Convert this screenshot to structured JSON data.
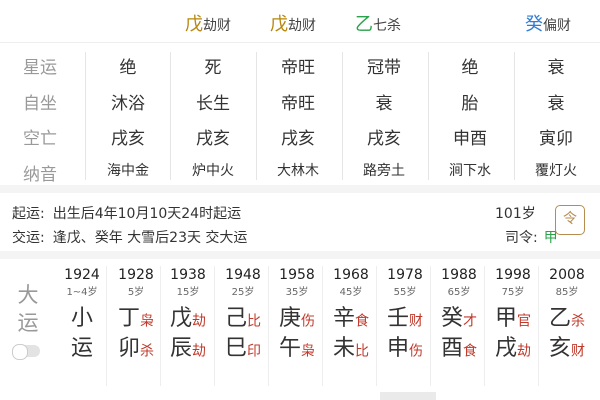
{
  "top_strip": [
    {
      "stem": "戊",
      "god": "劫财",
      "color": "#b8860b"
    },
    {
      "stem": "戊",
      "god": "劫财",
      "color": "#b8860b"
    },
    {
      "stem": "乙",
      "god": "七杀",
      "color": "#2aa24a"
    },
    {
      "stem": "癸",
      "god": "偏财",
      "color": "#2f7dd6"
    }
  ],
  "grid": {
    "rows": [
      {
        "label": "星运",
        "cells": [
          "绝",
          "死",
          "帝旺",
          "冠带",
          "绝",
          "衰"
        ]
      },
      {
        "label": "自坐",
        "cells": [
          "沐浴",
          "长生",
          "帝旺",
          "衰",
          "胎",
          "衰"
        ]
      },
      {
        "label": "空亡",
        "cells": [
          "戌亥",
          "戌亥",
          "戌亥",
          "戌亥",
          "申酉",
          "寅卯"
        ]
      },
      {
        "label": "纳音",
        "cells": [
          "海中金",
          "炉中火",
          "大林木",
          "路旁土",
          "涧下水",
          "覆灯火"
        ]
      }
    ]
  },
  "info": {
    "qiyun_label": "起运:",
    "qiyun_value": "出生后4年10月10天24时起运",
    "jiaoyun_label": "交运:",
    "jiaoyun_value": "逢戊、癸年 大雪后23天 交大运",
    "age_right": "101岁",
    "siling_label": "司令:",
    "siling_value": "甲",
    "ling_icon_char": "令"
  },
  "dayun": {
    "title": [
      "大",
      "运"
    ],
    "columns": [
      {
        "year": "1924",
        "age": "1~4岁",
        "g1": "小",
        "s1": "",
        "g2": "运",
        "s2": ""
      },
      {
        "year": "1928",
        "age": "5岁",
        "g1": "丁",
        "s1": "枭",
        "g2": "卯",
        "s2": "杀"
      },
      {
        "year": "1938",
        "age": "15岁",
        "g1": "戊",
        "s1": "劫",
        "g2": "辰",
        "s2": "劫"
      },
      {
        "year": "1948",
        "age": "25岁",
        "g1": "己",
        "s1": "比",
        "g2": "巳",
        "s2": "印"
      },
      {
        "year": "1958",
        "age": "35岁",
        "g1": "庚",
        "s1": "伤",
        "g2": "午",
        "s2": "枭"
      },
      {
        "year": "1968",
        "age": "45岁",
        "g1": "辛",
        "s1": "食",
        "g2": "未",
        "s2": "比"
      },
      {
        "year": "1978",
        "age": "55岁",
        "g1": "壬",
        "s1": "财",
        "g2": "申",
        "s2": "伤"
      },
      {
        "year": "1988",
        "age": "65岁",
        "g1": "癸",
        "s1": "才",
        "g2": "酉",
        "s2": "食"
      },
      {
        "year": "1998",
        "age": "75岁",
        "g1": "甲",
        "s1": "官",
        "g2": "戌",
        "s2": "劫"
      },
      {
        "year": "2008",
        "age": "85岁",
        "g1": "乙",
        "s1": "杀",
        "g2": "亥",
        "s2": "财"
      }
    ]
  },
  "colors": {
    "ten_god_red": "#c0392b",
    "label_gray": "#999999",
    "siling_green": "#2aa24a"
  }
}
